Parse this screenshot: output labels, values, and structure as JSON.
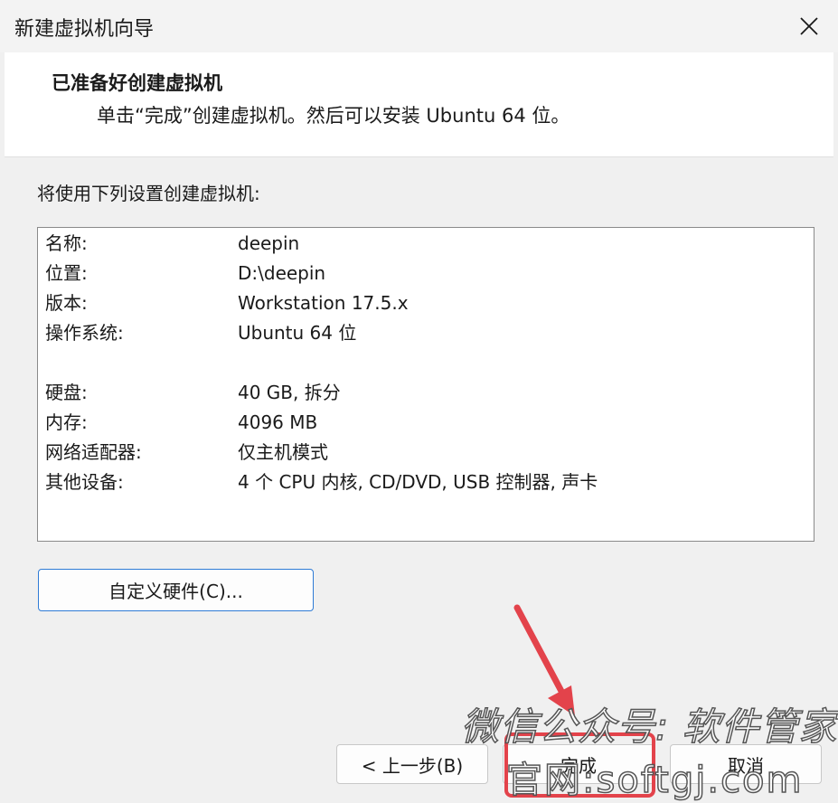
{
  "window": {
    "title": "新建虚拟机向导"
  },
  "header": {
    "title": "已准备好创建虚拟机",
    "subtitle": "单击“完成”创建虚拟机。然后可以安装 Ubuntu 64 位。"
  },
  "main": {
    "intro": "将使用下列设置创建虚拟机:",
    "summary": [
      {
        "label": "名称:",
        "value": "deepin"
      },
      {
        "label": "位置:",
        "value": "D:\\deepin"
      },
      {
        "label": "版本:",
        "value": "Workstation 17.5.x"
      },
      {
        "label": "操作系统:",
        "value": "Ubuntu 64 位"
      },
      {
        "label": "硬盘:",
        "value": "40 GB, 拆分"
      },
      {
        "label": "内存:",
        "value": "4096 MB"
      },
      {
        "label": "网络适配器:",
        "value": "仅主机模式"
      },
      {
        "label": "其他设备:",
        "value": "4 个 CPU 内核, CD/DVD, USB 控制器, 声卡"
      }
    ],
    "customize_label": "自定义硬件(C)..."
  },
  "buttons": {
    "back": "< 上一步(B)",
    "finish": "完成",
    "cancel": "取消"
  },
  "watermark": {
    "line1": "微信公众号: 软件管家",
    "line2": "官网:softgj.com"
  },
  "colors": {
    "accent": "#2f7bd6",
    "annotation": "#e3434b"
  },
  "icons": {
    "close": "close-icon"
  }
}
